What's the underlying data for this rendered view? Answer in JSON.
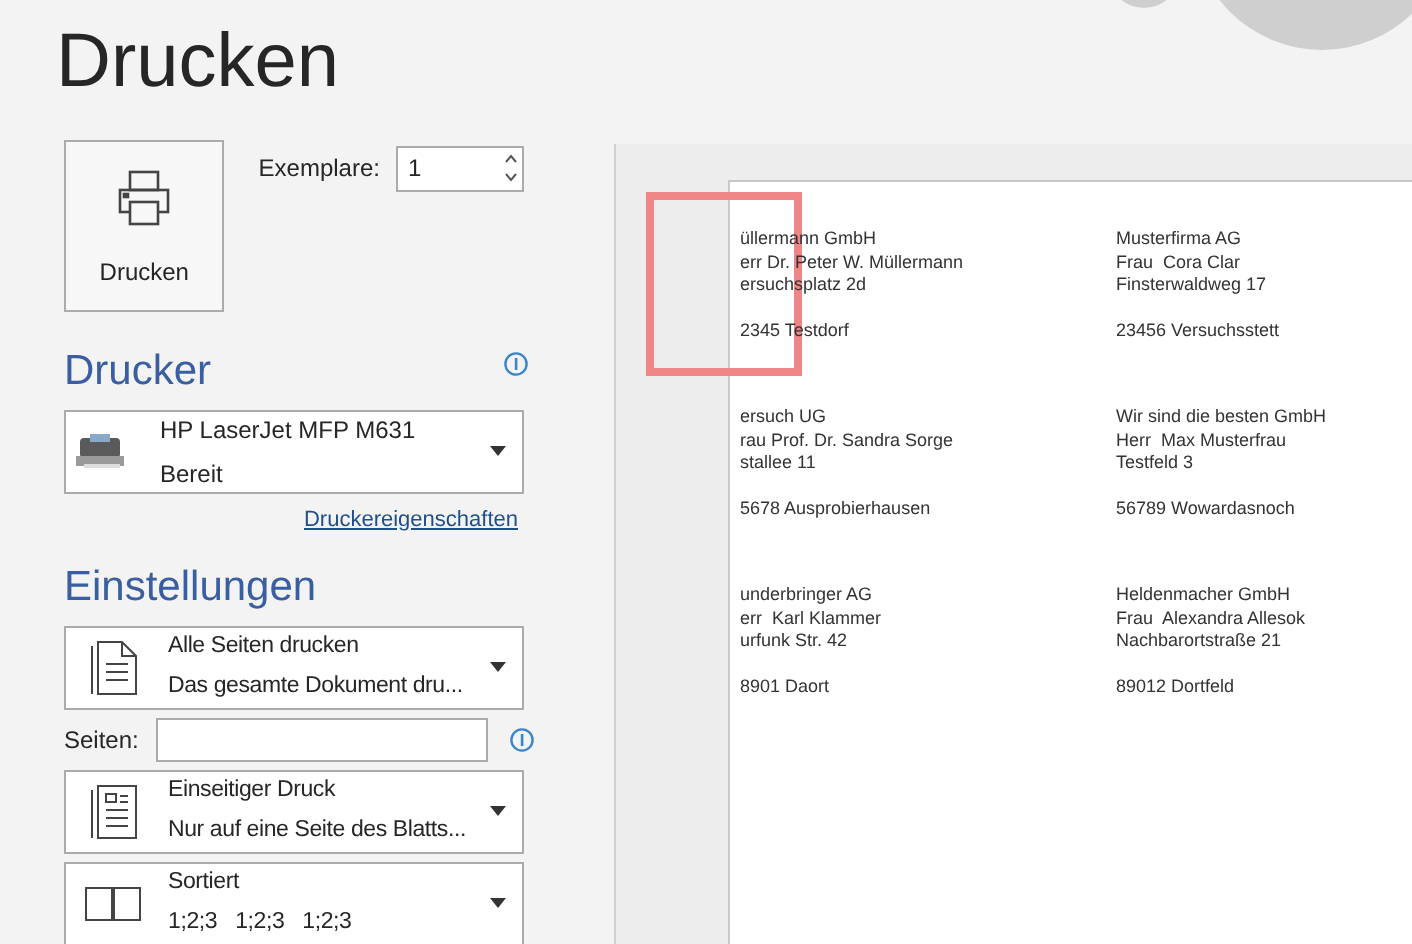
{
  "title": "Drucken",
  "print_button": {
    "label": "Drucken"
  },
  "copies": {
    "label": "Exemplare:",
    "value": "1"
  },
  "printer_section": {
    "heading": "Drucker",
    "printer": {
      "name": "HP LaserJet MFP M631",
      "status": "Bereit"
    },
    "properties_link": "Druckereigenschaften"
  },
  "settings": {
    "heading": "Einstellungen",
    "items": [
      {
        "kind": "dropdown",
        "title": "Alle Seiten drucken",
        "subtitle": "Das gesamte Dokument dru..."
      },
      {
        "kind": "field",
        "label": "Seiten:"
      },
      {
        "kind": "dropdown",
        "title": "Einseitiger Druck",
        "subtitle": "Nur auf eine Seite des Blatts..."
      },
      {
        "kind": "dropdown",
        "title": "Sortiert",
        "subtitle": "1;2;3   1;2;3   1;2;3"
      }
    ]
  },
  "preview": {
    "labels": [
      {
        "lines": [
          "üllermann GmbH",
          "err Dr. Peter W. Müllermann",
          "ersuchsplatz 2d",
          "2345 Testdorf"
        ]
      },
      {
        "lines": [
          "Musterfirma AG",
          "Frau  Cora Clar",
          "Finsterwaldweg 17",
          "23456 Versuchsstett"
        ]
      },
      {
        "lines": [
          "ersuch UG",
          "rau Prof. Dr. Sandra Sorge",
          "stallee 11",
          "5678 Ausprobierhausen"
        ]
      },
      {
        "lines": [
          "Wir sind die besten GmbH",
          "Herr  Max Musterfrau",
          "Testfeld 3",
          "56789 Wowardasnoch"
        ]
      },
      {
        "lines": [
          "underbringer AG",
          "err  Karl Klammer",
          "urfunk Str. 42",
          "8901 Daort"
        ]
      },
      {
        "lines": [
          "Heldenmacher GmbH",
          "Frau  Alexandra Allesok",
          "Nachbarortstraße 21",
          "89012 Dortfeld"
        ]
      }
    ]
  }
}
